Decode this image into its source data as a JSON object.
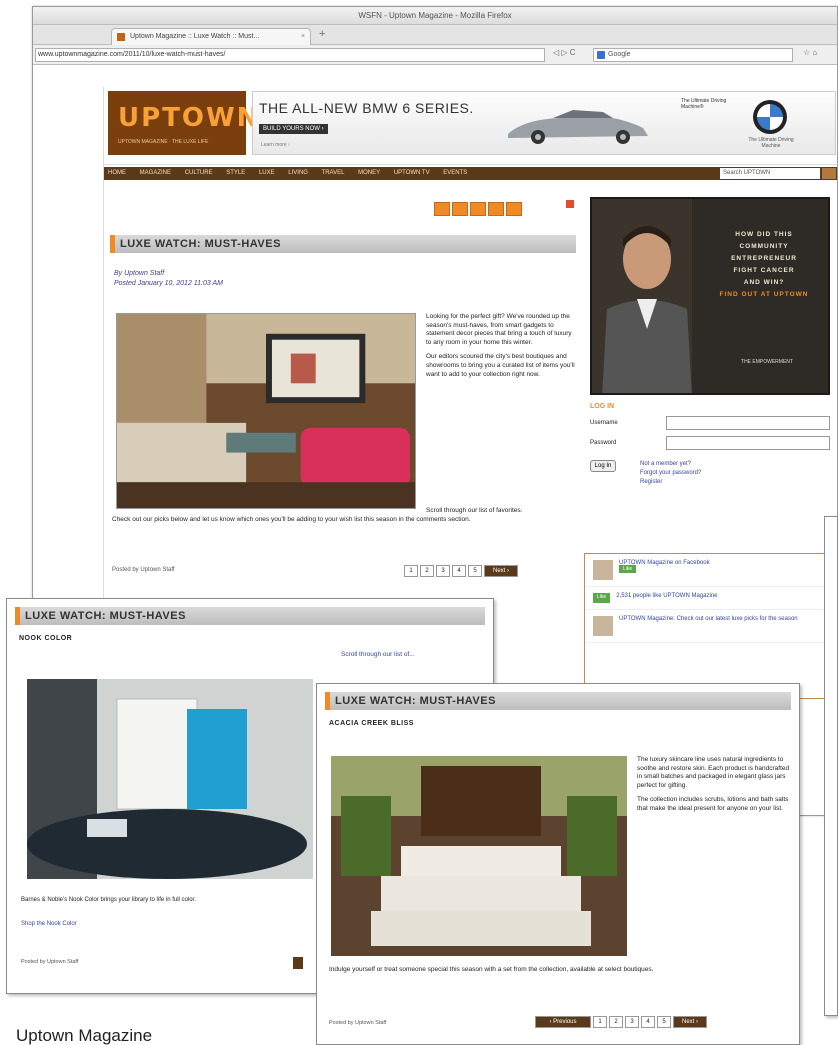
{
  "browser": {
    "title": "WSFN - Uptown Magazine - Mozilla Firefox",
    "tab_label": "Uptown Magazine :: Luxe Watch :: Must...",
    "url": "www.uptownmagazine.com/2011/10/luxe-watch-must-haves/",
    "search_placeholder": "Google",
    "nav_buttons": "◁ ▷ C",
    "tool_icons": "☆ ⌂"
  },
  "masthead": {
    "logo_name": "UPTOWN",
    "logo_tagline": "UPTOWN MAGAZINE · THE LUXE LIFE",
    "ad_headline": "THE ALL-NEW BMW 6 SERIES.",
    "ad_cta": "BUILD YOURS NOW ›",
    "ad_fine": "Learn more ›",
    "ad_small": "The Ultimate Driving Machine®",
    "bmw_caption": "The Ultimate Driving Machine"
  },
  "navbar": {
    "items": [
      "HOME",
      "MAGAZINE",
      "CULTURE",
      "STYLE",
      "LUXE",
      "LIVING",
      "TRAVEL",
      "MONEY",
      "UPTOWN TV",
      "EVENTS"
    ],
    "search": "Search UPTOWN"
  },
  "article": {
    "section": "LUXE WATCH: MUST-HAVES",
    "byline_1": "By Uptown Staff",
    "byline_2": "Posted January 10, 2012 11:03 AM",
    "para1": "Looking for the perfect gift? We've rounded up the season's must-haves, from smart gadgets to statement decor pieces that bring a touch of luxury to any room in your home this winter.",
    "para2": "Our editors scoured the city's best boutiques and showrooms to bring you a curated list of items you'll want to add to your collection right now.",
    "lead": "Scroll through our list of favorites.",
    "tail": "Check out our picks below and let us know which ones you'll be adding to your wish list this season in the comments section.",
    "posted": "Posted by Uptown Staff",
    "pager": [
      "1",
      "2",
      "3",
      "4",
      "5"
    ],
    "next_label": "Next ›",
    "prev_label": "‹ Previous"
  },
  "sidead": {
    "lines": [
      "HOW DID THIS",
      "COMMUNITY",
      "ENTREPRENEUR",
      "FIGHT CANCER",
      "AND WIN?"
    ],
    "orange": "FIND OUT AT UPTOWN",
    "brand": "THE EMPOWERMENT"
  },
  "login": {
    "title": "LOG IN",
    "username_label": "Username",
    "password_label": "Password",
    "button": "Log In",
    "link1": "Not a member yet?",
    "link2": "Forgot your password?",
    "link3": "Register"
  },
  "facebook": {
    "page_name": "UPTOWN Magazine on Facebook",
    "like_label": "Like",
    "row2": "2,531 people like UPTOWN Magazine",
    "row3": "UPTOWN Magazine: Check out our latest luxe picks for the season"
  },
  "crop1": {
    "section": "LUXE WATCH: MUST-HAVES",
    "subhead": "NOOK COLOR",
    "intro": "Scroll through our list of...",
    "tail": "Barnes & Noble's Nook Color brings your library to life in full color.",
    "link": "Shop the Nook Color",
    "posted": "Posted by Uptown Staff"
  },
  "crop2": {
    "section": "LUXE WATCH: MUST-HAVES",
    "subhead": "ACACIA CREEK BLISS",
    "para1": "The luxury skincare line uses natural ingredients to soothe and restore skin. Each product is handcrafted in small batches and packaged in elegant glass jars perfect for gifting.",
    "para2": "The collection includes scrubs, lotions and bath salts that make the ideal present for anyone on your list.",
    "tail": "Indulge yourself or treat someone special this season with a set from the collection, available at select boutiques.",
    "posted": "Posted by Uptown Staff"
  },
  "caption": "Uptown Magazine"
}
